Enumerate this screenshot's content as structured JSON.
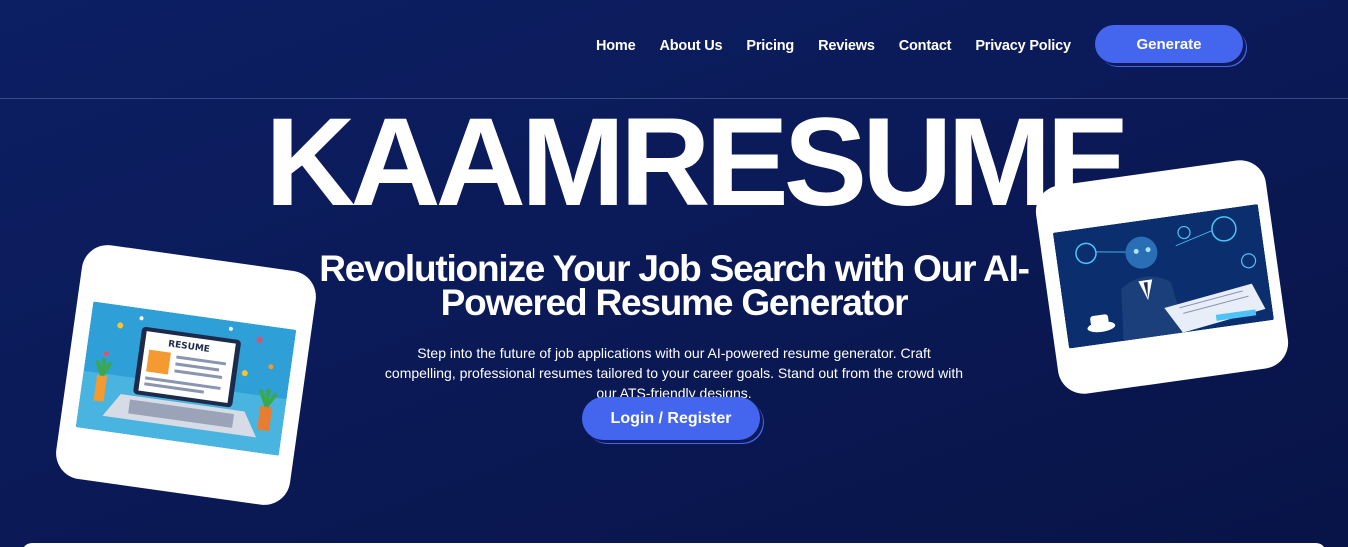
{
  "nav": {
    "links": [
      {
        "label": "Home"
      },
      {
        "label": "About Us"
      },
      {
        "label": "Pricing"
      },
      {
        "label": "Reviews"
      },
      {
        "label": "Contact"
      },
      {
        "label": "Privacy Policy"
      }
    ],
    "generate_label": "Generate"
  },
  "hero": {
    "brand": "KAAMRESUME",
    "title": "Revolutionize Your Job Search with Our AI-Powered Resume Generator",
    "description": "Step into the future of job applications with our AI-powered resume generator. Craft compelling, professional resumes tailored to your career goals. Stand out from the crowd with our ATS-friendly designs.",
    "cta_label": "Login / Register"
  },
  "images": {
    "left": {
      "screen_word": "RESUME"
    }
  },
  "colors": {
    "background": "#0b1a58",
    "accent": "#4466ee",
    "text": "#ffffff"
  }
}
